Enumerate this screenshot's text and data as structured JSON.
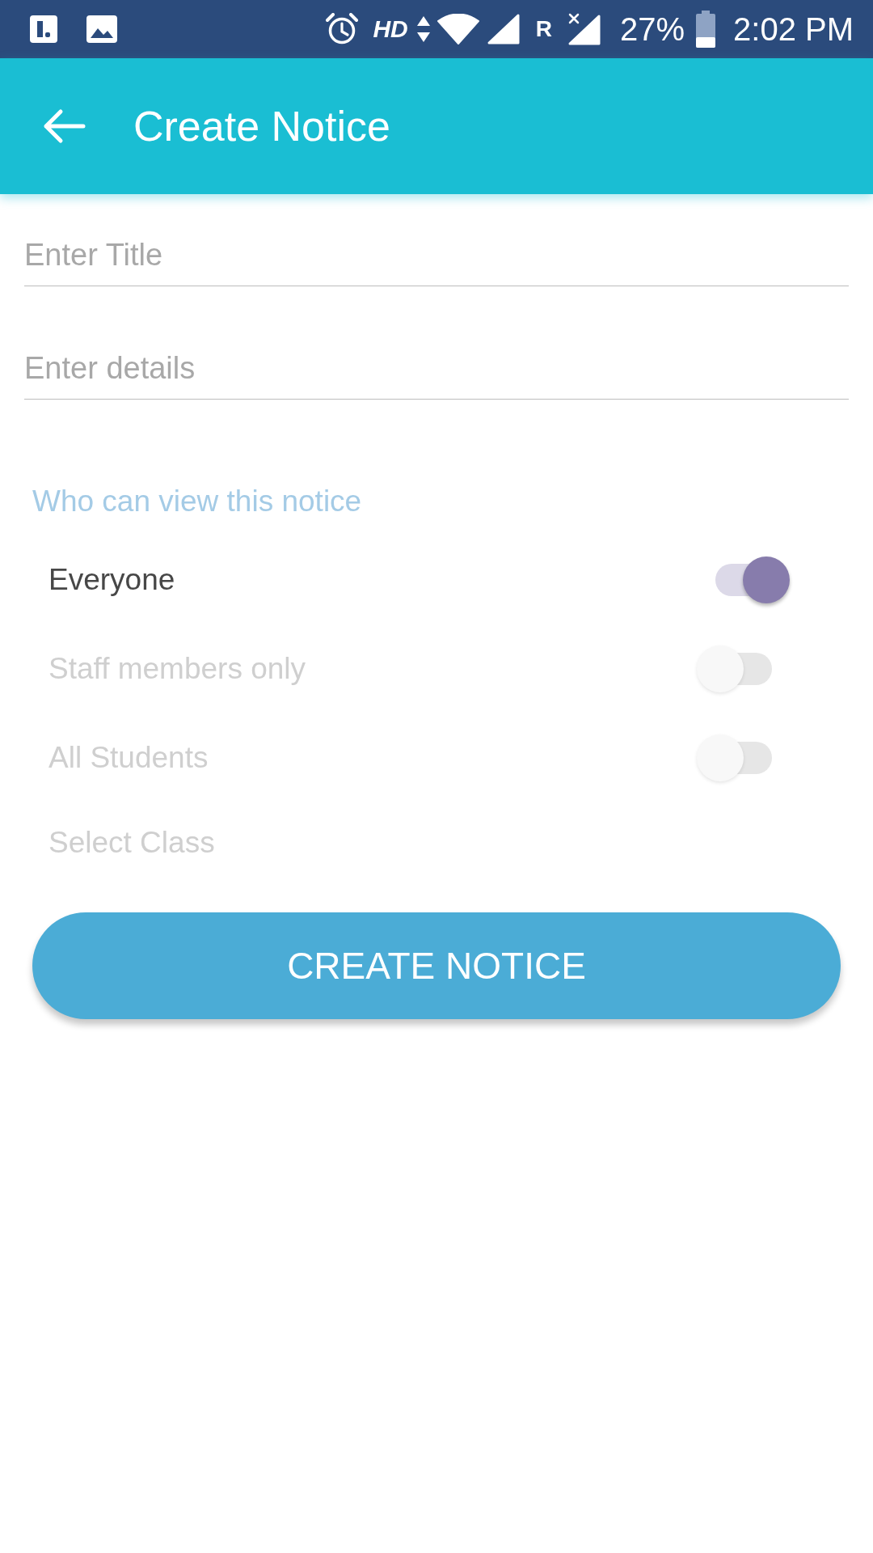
{
  "status_bar": {
    "network_type": "HD",
    "roaming": "R",
    "battery": "27%",
    "time": "2:02 PM"
  },
  "app_bar": {
    "title": "Create Notice"
  },
  "fields": [
    {
      "placeholder": "Enter Title"
    },
    {
      "placeholder": "Enter details"
    }
  ],
  "visibility": {
    "heading": "Who can view this notice",
    "options": [
      {
        "label": "Everyone",
        "on": true,
        "disabled": false
      },
      {
        "label": "Staff members only",
        "on": false,
        "disabled": true
      },
      {
        "label": "All Students",
        "on": false,
        "disabled": true
      }
    ],
    "class_select": {
      "label": "Select Class",
      "disabled": true
    }
  },
  "submit_button": {
    "label": "CREATE NOTICE"
  }
}
